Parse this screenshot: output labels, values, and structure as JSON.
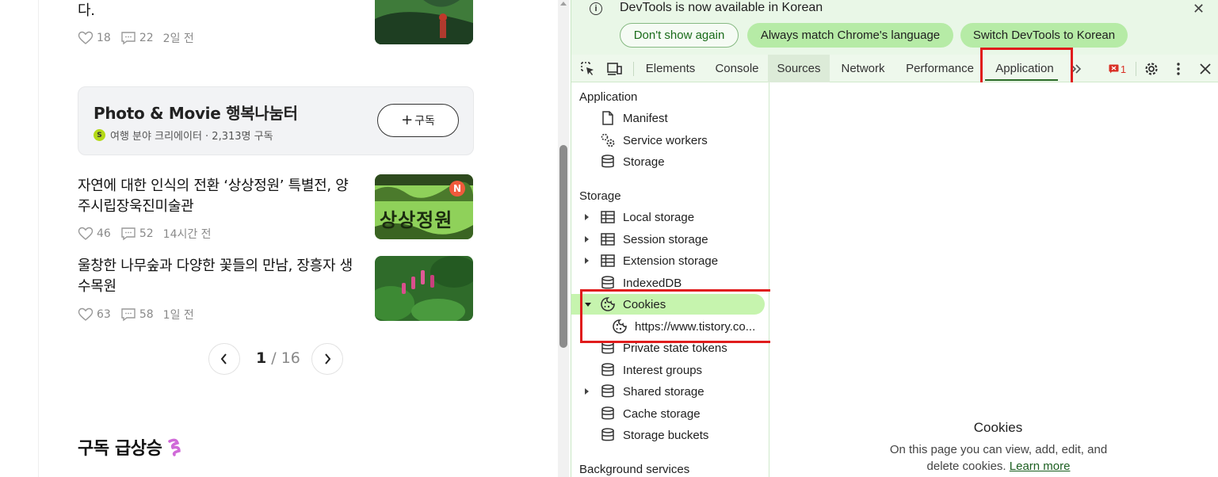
{
  "blog": {
    "post_top": {
      "title": "다.",
      "likes": "18",
      "comments": "22",
      "time": "2일 전"
    },
    "subscribe_card": {
      "title": "Photo & Movie 행복나눔터",
      "badge": "S",
      "info": "여행 분야 크리에이터 · 2,313명 구독",
      "button_label": "구독"
    },
    "posts": [
      {
        "title": "자연에 대한 인식의 전환 ‘상상정원’ 특별전, 양주시립장욱진미술관",
        "likes": "46",
        "comments": "52",
        "time": "14시간 전",
        "thumb_badge": "N",
        "thumb_text": "상상정원"
      },
      {
        "title": "울창한 나무숲과 다양한 꽃들의 만남, 장흥자 생수목원",
        "likes": "63",
        "comments": "58",
        "time": "1일 전"
      }
    ],
    "pager": {
      "current": "1",
      "separator": " / ",
      "total": "16"
    },
    "section_heading": "구독 급상승"
  },
  "devtools": {
    "infobar": {
      "message": "DevTools is now available in Korean",
      "dont_show": "Don't show again",
      "always_match": "Always match Chrome's language",
      "switch": "Switch DevTools to Korean"
    },
    "tabs": [
      "Elements",
      "Console",
      "Sources",
      "Network",
      "Performance",
      "Application"
    ],
    "selected_tab": "Application",
    "issues_count": "1",
    "sidebar": {
      "application_header": "Application",
      "application_items": [
        "Manifest",
        "Service workers",
        "Storage"
      ],
      "storage_header": "Storage",
      "storage_items": [
        "Local storage",
        "Session storage",
        "Extension storage",
        "IndexedDB",
        "Cookies",
        "https://www.tistory.co...",
        "Private state tokens",
        "Interest groups",
        "Shared storage",
        "Cache storage",
        "Storage buckets"
      ],
      "background_header": "Background services"
    },
    "main": {
      "title": "Cookies",
      "description": "On this page you can view, add, edit, and delete cookies.",
      "learn_more": "Learn more"
    },
    "accent_color": "#e01c1c"
  }
}
